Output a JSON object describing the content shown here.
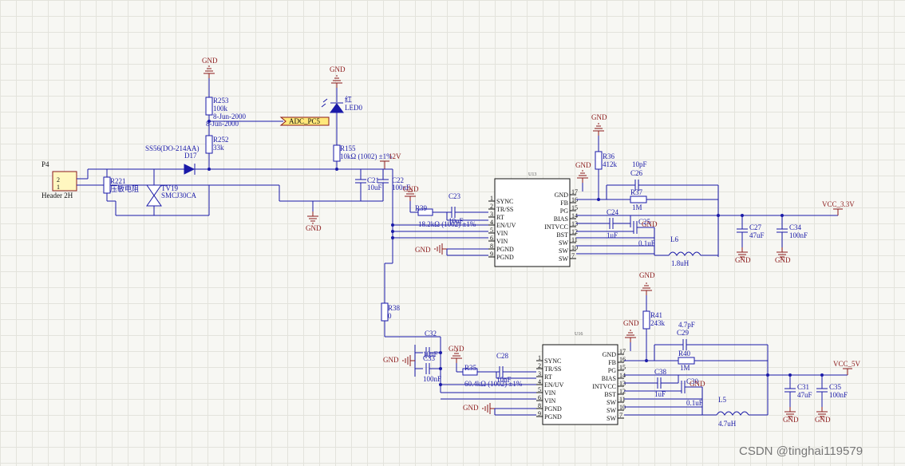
{
  "gnd_label": "GND",
  "header": {
    "ref": "P4",
    "name": "Header 2H",
    "pin2": "2",
    "pin1": "1"
  },
  "r221": {
    "ref": "R221",
    "desc": "压敏电阻"
  },
  "tv19": {
    "ref": "TV19",
    "value": "SMCJ30CA"
  },
  "d17": {
    "part": "SS56(DO-214AA)",
    "ref": "D17"
  },
  "r253": {
    "ref": "R253",
    "value": "100k",
    "date": "8-Jun-2000"
  },
  "r252": {
    "ref": "R252",
    "value": "33k",
    "date": "8-Jun-2000"
  },
  "adc_net": "ADC_PC5",
  "led": {
    "color": "红",
    "ref": "LED0"
  },
  "r155": {
    "ref": "R155",
    "value": "10kΩ (1002) ±1%"
  },
  "net_12v": "12V",
  "c21": {
    "ref": "C21",
    "value": "10uF"
  },
  "c22": {
    "ref": "C22",
    "value": "100nF"
  },
  "u13": {
    "ref": "U13",
    "left_pins": [
      "SYNC",
      "TR/SS",
      "RT",
      "EN/UV",
      "VIN",
      "VIN",
      "PGND",
      "PGND"
    ],
    "left_nums": [
      "1",
      "2",
      "3",
      "4",
      "5",
      "6",
      "8",
      "9"
    ],
    "right_pins": [
      "GND",
      "FB",
      "PG",
      "BIAS",
      "INTVCC",
      "BST",
      "SW",
      "SW",
      "SW"
    ],
    "right_nums": [
      "17",
      "16",
      "15",
      "14",
      "13",
      "12",
      "11",
      "10",
      "7"
    ]
  },
  "u16": {
    "ref": "U16",
    "left_pins": [
      "SYNC",
      "TR/SS",
      "RT",
      "EN/UV",
      "VIN",
      "VIN",
      "PGND",
      "PGND"
    ],
    "left_nums": [
      "1",
      "2",
      "3",
      "4",
      "5",
      "6",
      "8",
      "9"
    ],
    "right_pins": [
      "GND",
      "FB",
      "PG",
      "BIAS",
      "INTVCC",
      "BST",
      "SW",
      "SW",
      "SW"
    ],
    "right_nums": [
      "17",
      "16",
      "15",
      "14",
      "13",
      "12",
      "11",
      "10",
      "7"
    ]
  },
  "c23": {
    "ref": "C23",
    "value": "10nF"
  },
  "r39": {
    "ref": "R39",
    "value": "18.2kΩ (1002) ±1%"
  },
  "r36": {
    "ref": "R36",
    "value": "412k"
  },
  "c26": {
    "ref": "C26",
    "value": "10pF"
  },
  "r37": {
    "ref": "R37",
    "value": "1M"
  },
  "c24": {
    "ref": "C24",
    "value": "1uF"
  },
  "c25": {
    "ref": "C25",
    "value": "0.1uF"
  },
  "l6": {
    "ref": "L6",
    "value": "1.8uH"
  },
  "c27": {
    "ref": "C27",
    "value": "47uF"
  },
  "c34": {
    "ref": "C34",
    "value": "100nF"
  },
  "net_3v3": "VCC_3.3V",
  "r38": {
    "ref": "R38",
    "value": "0"
  },
  "c32": {
    "ref": "C32",
    "value": "10uF"
  },
  "c33": {
    "ref": "C33",
    "value": "100nF"
  },
  "c28": {
    "ref": "C28",
    "value": "10nF"
  },
  "r35": {
    "ref": "R35",
    "value": "60.4kΩ (1002) ±1%"
  },
  "r41": {
    "ref": "R41",
    "value": "243k"
  },
  "c29": {
    "ref": "C29",
    "value": "4.7pF"
  },
  "r40": {
    "ref": "R40",
    "value": "1M"
  },
  "c38": {
    "ref": "C38",
    "value": "1uF"
  },
  "c30": {
    "ref": "C30",
    "value": "0.1uF"
  },
  "l5": {
    "ref": "L5",
    "value": "4.7uH"
  },
  "c31": {
    "ref": "C31",
    "value": "47uF"
  },
  "c35": {
    "ref": "C35",
    "value": "100nF"
  },
  "net_5v": "VCC_5V",
  "watermark": "CSDN @tinghai119579"
}
